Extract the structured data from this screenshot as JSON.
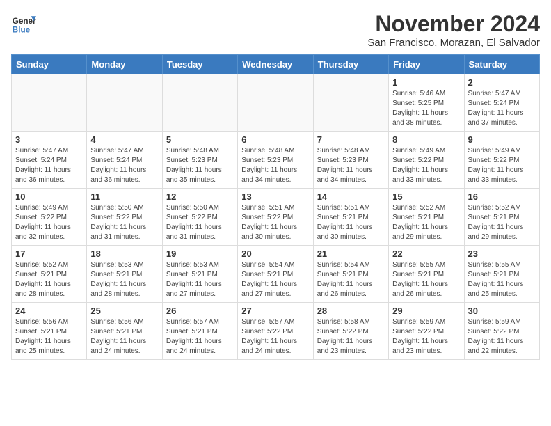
{
  "header": {
    "logo_line1": "General",
    "logo_line2": "Blue",
    "month_title": "November 2024",
    "location": "San Francisco, Morazan, El Salvador"
  },
  "days_of_week": [
    "Sunday",
    "Monday",
    "Tuesday",
    "Wednesday",
    "Thursday",
    "Friday",
    "Saturday"
  ],
  "weeks": [
    [
      {
        "day": "",
        "info": ""
      },
      {
        "day": "",
        "info": ""
      },
      {
        "day": "",
        "info": ""
      },
      {
        "day": "",
        "info": ""
      },
      {
        "day": "",
        "info": ""
      },
      {
        "day": "1",
        "info": "Sunrise: 5:46 AM\nSunset: 5:25 PM\nDaylight: 11 hours\nand 38 minutes."
      },
      {
        "day": "2",
        "info": "Sunrise: 5:47 AM\nSunset: 5:24 PM\nDaylight: 11 hours\nand 37 minutes."
      }
    ],
    [
      {
        "day": "3",
        "info": "Sunrise: 5:47 AM\nSunset: 5:24 PM\nDaylight: 11 hours\nand 36 minutes."
      },
      {
        "day": "4",
        "info": "Sunrise: 5:47 AM\nSunset: 5:24 PM\nDaylight: 11 hours\nand 36 minutes."
      },
      {
        "day": "5",
        "info": "Sunrise: 5:48 AM\nSunset: 5:23 PM\nDaylight: 11 hours\nand 35 minutes."
      },
      {
        "day": "6",
        "info": "Sunrise: 5:48 AM\nSunset: 5:23 PM\nDaylight: 11 hours\nand 34 minutes."
      },
      {
        "day": "7",
        "info": "Sunrise: 5:48 AM\nSunset: 5:23 PM\nDaylight: 11 hours\nand 34 minutes."
      },
      {
        "day": "8",
        "info": "Sunrise: 5:49 AM\nSunset: 5:22 PM\nDaylight: 11 hours\nand 33 minutes."
      },
      {
        "day": "9",
        "info": "Sunrise: 5:49 AM\nSunset: 5:22 PM\nDaylight: 11 hours\nand 33 minutes."
      }
    ],
    [
      {
        "day": "10",
        "info": "Sunrise: 5:49 AM\nSunset: 5:22 PM\nDaylight: 11 hours\nand 32 minutes."
      },
      {
        "day": "11",
        "info": "Sunrise: 5:50 AM\nSunset: 5:22 PM\nDaylight: 11 hours\nand 31 minutes."
      },
      {
        "day": "12",
        "info": "Sunrise: 5:50 AM\nSunset: 5:22 PM\nDaylight: 11 hours\nand 31 minutes."
      },
      {
        "day": "13",
        "info": "Sunrise: 5:51 AM\nSunset: 5:22 PM\nDaylight: 11 hours\nand 30 minutes."
      },
      {
        "day": "14",
        "info": "Sunrise: 5:51 AM\nSunset: 5:21 PM\nDaylight: 11 hours\nand 30 minutes."
      },
      {
        "day": "15",
        "info": "Sunrise: 5:52 AM\nSunset: 5:21 PM\nDaylight: 11 hours\nand 29 minutes."
      },
      {
        "day": "16",
        "info": "Sunrise: 5:52 AM\nSunset: 5:21 PM\nDaylight: 11 hours\nand 29 minutes."
      }
    ],
    [
      {
        "day": "17",
        "info": "Sunrise: 5:52 AM\nSunset: 5:21 PM\nDaylight: 11 hours\nand 28 minutes."
      },
      {
        "day": "18",
        "info": "Sunrise: 5:53 AM\nSunset: 5:21 PM\nDaylight: 11 hours\nand 28 minutes."
      },
      {
        "day": "19",
        "info": "Sunrise: 5:53 AM\nSunset: 5:21 PM\nDaylight: 11 hours\nand 27 minutes."
      },
      {
        "day": "20",
        "info": "Sunrise: 5:54 AM\nSunset: 5:21 PM\nDaylight: 11 hours\nand 27 minutes."
      },
      {
        "day": "21",
        "info": "Sunrise: 5:54 AM\nSunset: 5:21 PM\nDaylight: 11 hours\nand 26 minutes."
      },
      {
        "day": "22",
        "info": "Sunrise: 5:55 AM\nSunset: 5:21 PM\nDaylight: 11 hours\nand 26 minutes."
      },
      {
        "day": "23",
        "info": "Sunrise: 5:55 AM\nSunset: 5:21 PM\nDaylight: 11 hours\nand 25 minutes."
      }
    ],
    [
      {
        "day": "24",
        "info": "Sunrise: 5:56 AM\nSunset: 5:21 PM\nDaylight: 11 hours\nand 25 minutes."
      },
      {
        "day": "25",
        "info": "Sunrise: 5:56 AM\nSunset: 5:21 PM\nDaylight: 11 hours\nand 24 minutes."
      },
      {
        "day": "26",
        "info": "Sunrise: 5:57 AM\nSunset: 5:21 PM\nDaylight: 11 hours\nand 24 minutes."
      },
      {
        "day": "27",
        "info": "Sunrise: 5:57 AM\nSunset: 5:22 PM\nDaylight: 11 hours\nand 24 minutes."
      },
      {
        "day": "28",
        "info": "Sunrise: 5:58 AM\nSunset: 5:22 PM\nDaylight: 11 hours\nand 23 minutes."
      },
      {
        "day": "29",
        "info": "Sunrise: 5:59 AM\nSunset: 5:22 PM\nDaylight: 11 hours\nand 23 minutes."
      },
      {
        "day": "30",
        "info": "Sunrise: 5:59 AM\nSunset: 5:22 PM\nDaylight: 11 hours\nand 22 minutes."
      }
    ]
  ]
}
